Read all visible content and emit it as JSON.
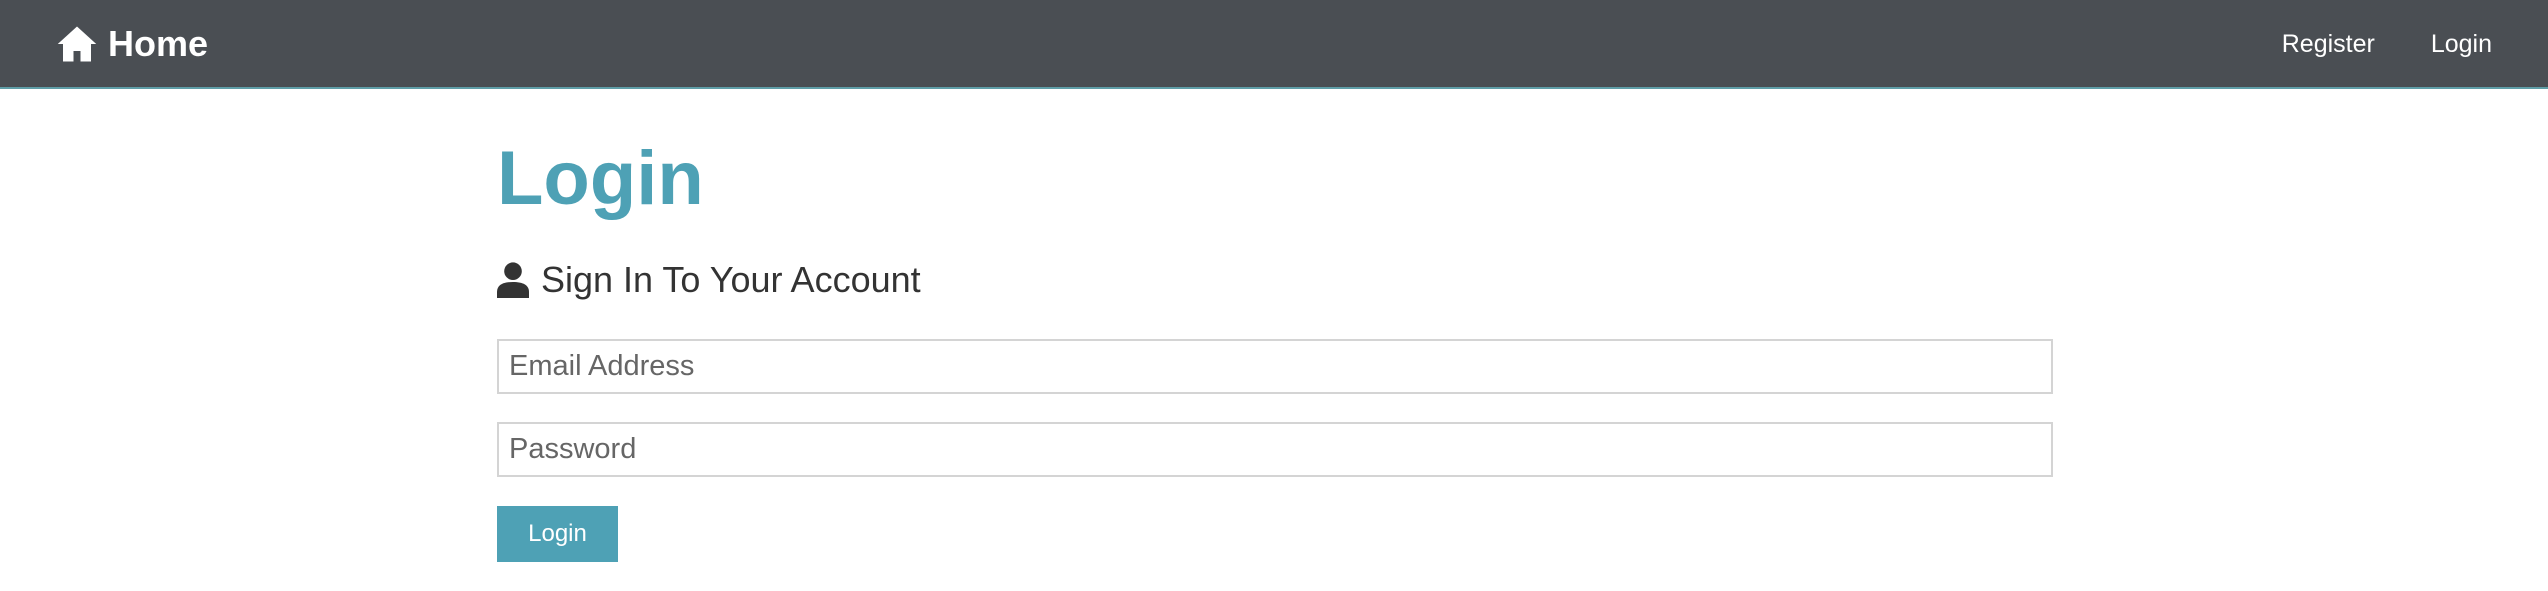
{
  "navbar": {
    "brand_label": "Home",
    "brand_icon": "home-icon",
    "links": [
      {
        "label": "Register"
      },
      {
        "label": "Login"
      }
    ]
  },
  "main": {
    "title": "Login",
    "subtitle": "Sign In To Your Account",
    "subtitle_icon": "user-icon",
    "email_placeholder": "Email Address",
    "email_value": "",
    "password_placeholder": "Password",
    "password_value": "",
    "submit_label": "Login"
  },
  "colors": {
    "navbar_bg": "#4a4e53",
    "accent": "#4ea1b5",
    "text": "#333333"
  }
}
